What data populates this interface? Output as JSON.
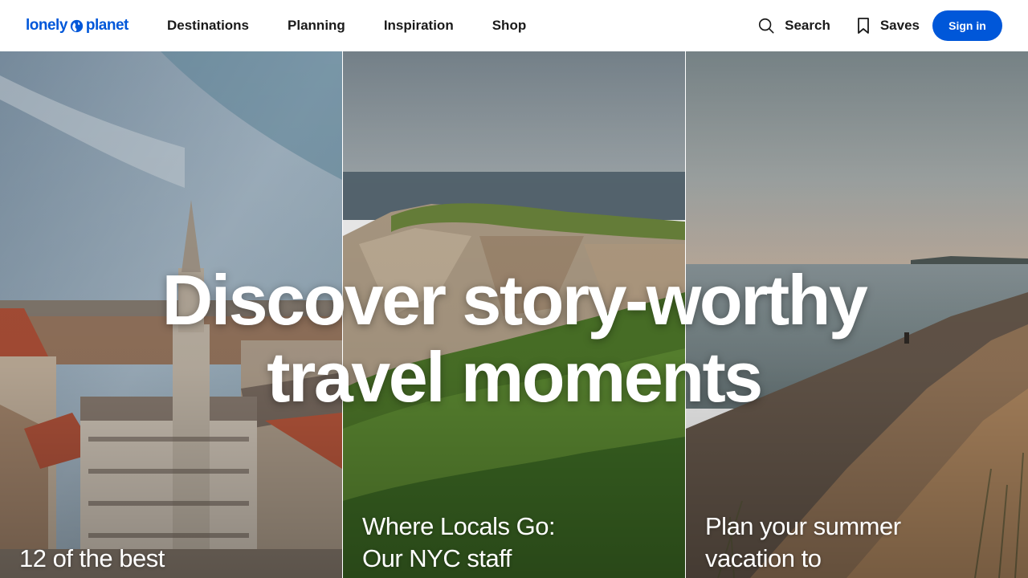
{
  "header": {
    "logo_text_left": "lonely",
    "logo_text_right": "planet",
    "nav": [
      "Destinations",
      "Planning",
      "Inspiration",
      "Shop"
    ],
    "search_label": "Search",
    "saves_label": "Saves",
    "signin_label": "Sign in"
  },
  "hero": {
    "headline_line1": "Discover story-worthy",
    "headline_line2": "travel moments",
    "panels": [
      {
        "caption_line1": "12 of the best",
        "caption_line2": ""
      },
      {
        "caption_line1": "Where Locals Go:",
        "caption_line2": "Our NYC staff"
      },
      {
        "caption_line1": "Plan your summer",
        "caption_line2": "vacation to"
      }
    ]
  },
  "colors": {
    "brand": "#0057d9",
    "text": "#1a1a1a"
  }
}
